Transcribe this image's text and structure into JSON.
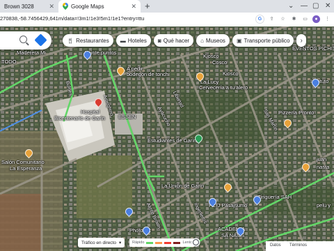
{
  "browser": {
    "tabs": [
      {
        "label": "Brown 3028",
        "active": false
      },
      {
        "label": "Google Maps",
        "active": true
      }
    ],
    "new_tab_symbol": "+",
    "window_controls": [
      "⌄",
      "—",
      "▢",
      "✕"
    ],
    "url": "270838,-58.7456429,641m/data=!3m1!1e3!5m1!1e1?entry=ttu"
  },
  "map": {
    "search_icon": "search-icon",
    "directions_icon": "directions-icon",
    "chips": [
      {
        "icon": "restaurant-icon",
        "label": "Restaurantes"
      },
      {
        "icon": "hotel-icon",
        "label": "Hoteles"
      },
      {
        "icon": "camera-icon",
        "label": "Qué hacer"
      },
      {
        "icon": "museum-icon",
        "label": "Museos"
      },
      {
        "icon": "transit-icon",
        "label": "Transporte público"
      }
    ],
    "chips_more": "›",
    "labels": {
      "maderera": "Maderera Mi",
      "todo": "TODO",
      "kiosco_cosco": "Kiosco",
      "cosco": "Cosco",
      "veinte": "Veinte puntos",
      "a_pedir": "A pedir",
      "bodegon": "bodegón de tonch",
      "eventos": "EVENTOS PICHITITO",
      "la_lucy": "La Lucy",
      "cerveceria": "Cervecería a tu alero",
      "kiosco2": "Kiosco",
      "hospital": "Hospital",
      "bicentenario": "Bicentenario de Garín",
      "essen": "ESSEN",
      "pizzeria": "Pizzería Pronto",
      "instituto": "Instituto",
      "estudiantes": "Estudiantes de Garín",
      "juan": "juan",
      "nasta": "nasta",
      "salon": "Salón Comunitario",
      "esperanza": "La Esperanza",
      "union": "La Unión de Garín",
      "zingueria": "Zinguería SAH",
      "pasaj": "PCIJ Pasajsumo",
      "academia": "ACADEMIA",
      "nails": "SA NAILS",
      "photo": "Photo Art",
      "pelu": "pelu y",
      "bulnes": "Bulnes",
      "ameghino": "Ameghino",
      "ayacucho": "Ayacucho",
      "alte_brown": "Almte Brown",
      "san_martin": "San Martín",
      "libertad": "Libertad",
      "ingenieros": "Ingenieros"
    }
  },
  "traffic": {
    "label": "Tráfico en directo",
    "dropdown": "▾",
    "fast": "Rápido",
    "slow": "Lento",
    "colors": [
      "#63d668",
      "#ff974d",
      "#f23c32",
      "#811f1f"
    ]
  },
  "footer": {
    "items": [
      "Datos",
      "Términos"
    ]
  }
}
